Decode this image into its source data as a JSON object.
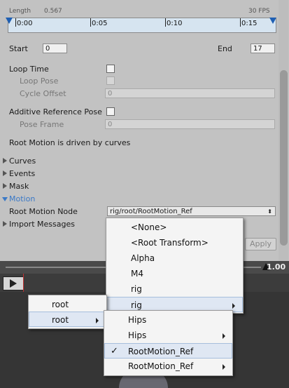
{
  "clip": {
    "length_label": "Length",
    "length_value": "0.567",
    "fps": "30 FPS"
  },
  "timeline": {
    "ticks": [
      "0:00",
      "0:05",
      "0:10",
      "0:15"
    ]
  },
  "range": {
    "start_label": "Start",
    "start_value": "0",
    "end_label": "End",
    "end_value": "17"
  },
  "loop": {
    "loop_time": "Loop Time",
    "loop_pose": "Loop Pose",
    "cycle_offset": "Cycle Offset",
    "cycle_offset_value": "0"
  },
  "additive": {
    "label": "Additive Reference Pose",
    "pose_frame": "Pose Frame",
    "pose_frame_value": "0"
  },
  "root_motion_note": "Root Motion is driven by curves",
  "sections": {
    "curves": "Curves",
    "events": "Events",
    "mask": "Mask",
    "motion": "Motion",
    "import_messages": "Import Messages"
  },
  "root_motion_node": {
    "label": "Root Motion Node",
    "value": "rig/root/RootMotion_Ref"
  },
  "apply_label": "Apply",
  "preview": {
    "speed": "1.00"
  },
  "menus": {
    "main": [
      "<None>",
      "<Root Transform>",
      "Alpha",
      "M4",
      "rig",
      "rig"
    ],
    "root_menu": [
      "root",
      "root"
    ],
    "rig_menu": [
      "Hips",
      "Hips",
      "RootMotion_Ref",
      "RootMotion_Ref"
    ]
  },
  "colors": {
    "accent": "#3b79c7",
    "timeline_bg": "#d6e4f0",
    "panel": "#c2c2c2"
  }
}
